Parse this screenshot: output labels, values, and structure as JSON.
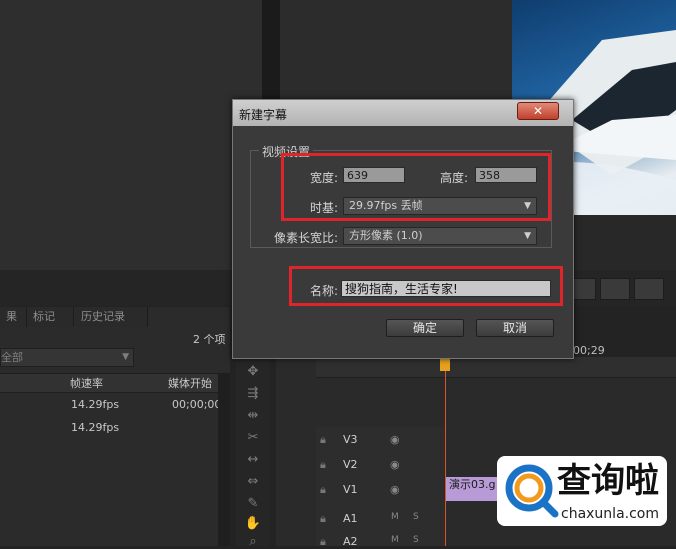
{
  "dialog": {
    "title": "新建字幕",
    "close_glyph": "✕",
    "group_title": "视频设置",
    "width_label": "宽度:",
    "width_value": "639",
    "height_label": "高度:",
    "height_value": "358",
    "timebase_label": "时基:",
    "timebase_value": "29.97fps 丢帧",
    "aspect_label": "像素长宽比:",
    "aspect_value": "方形像素 (1.0)",
    "name_label": "名称:",
    "name_value": "搜狗指南，生活专家!",
    "ok_label": "确定",
    "cancel_label": "取消",
    "accent_red": "#e0242c"
  },
  "project_panel": {
    "tabs": [
      "果",
      "标记",
      "历史记录"
    ],
    "item_count": "2 个项",
    "filter_value": "全部",
    "columns": [
      "帧速率",
      "媒体开始"
    ],
    "rows": [
      {
        "fps": "14.29fps",
        "start": "00;00;00"
      },
      {
        "fps": "14.29fps",
        "start": ""
      }
    ]
  },
  "timeline": {
    "timecode": "00;29",
    "tracks": [
      "V3",
      "V2",
      "V1",
      "A1",
      "A2"
    ],
    "track_button_m": "M",
    "track_button_s": "S",
    "clip_label": "演示03.g"
  },
  "watermark": {
    "brand": "查询啦",
    "domain": "chaxunla.com"
  }
}
